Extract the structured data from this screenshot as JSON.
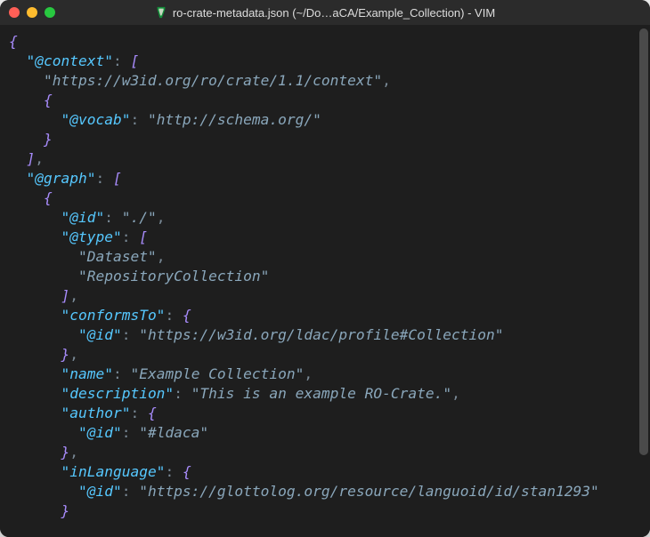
{
  "window": {
    "title": "ro-crate-metadata.json (~/Do…aCA/Example_Collection) - VIM",
    "icon_name": "vim-icon"
  },
  "code": {
    "lines": [
      {
        "indent": 0,
        "tokens": [
          {
            "t": "brace",
            "v": "{"
          }
        ]
      },
      {
        "indent": 1,
        "tokens": [
          {
            "t": "key",
            "v": "\"@context\""
          },
          {
            "t": "punct",
            "v": ":"
          },
          {
            "t": "sp",
            "v": " "
          },
          {
            "t": "brace",
            "v": "["
          }
        ]
      },
      {
        "indent": 2,
        "tokens": [
          {
            "t": "str",
            "v": "\"https://w3id.org/ro/crate/1.1/context\""
          },
          {
            "t": "comma",
            "v": ","
          }
        ]
      },
      {
        "indent": 2,
        "tokens": [
          {
            "t": "brace",
            "v": "{"
          }
        ]
      },
      {
        "indent": 3,
        "tokens": [
          {
            "t": "key",
            "v": "\"@vocab\""
          },
          {
            "t": "punct",
            "v": ":"
          },
          {
            "t": "sp",
            "v": " "
          },
          {
            "t": "str",
            "v": "\"http://schema.org/\""
          }
        ]
      },
      {
        "indent": 2,
        "tokens": [
          {
            "t": "brace",
            "v": "}"
          }
        ]
      },
      {
        "indent": 1,
        "tokens": [
          {
            "t": "brace",
            "v": "]"
          },
          {
            "t": "comma",
            "v": ","
          }
        ]
      },
      {
        "indent": 1,
        "tokens": [
          {
            "t": "key",
            "v": "\"@graph\""
          },
          {
            "t": "punct",
            "v": ":"
          },
          {
            "t": "sp",
            "v": " "
          },
          {
            "t": "brace",
            "v": "["
          }
        ]
      },
      {
        "indent": 2,
        "tokens": [
          {
            "t": "brace",
            "v": "{"
          }
        ]
      },
      {
        "indent": 3,
        "tokens": [
          {
            "t": "key",
            "v": "\"@id\""
          },
          {
            "t": "punct",
            "v": ":"
          },
          {
            "t": "sp",
            "v": " "
          },
          {
            "t": "str",
            "v": "\"./\""
          },
          {
            "t": "comma",
            "v": ","
          }
        ]
      },
      {
        "indent": 3,
        "tokens": [
          {
            "t": "key",
            "v": "\"@type\""
          },
          {
            "t": "punct",
            "v": ":"
          },
          {
            "t": "sp",
            "v": " "
          },
          {
            "t": "brace",
            "v": "["
          }
        ]
      },
      {
        "indent": 4,
        "tokens": [
          {
            "t": "str",
            "v": "\"Dataset\""
          },
          {
            "t": "comma",
            "v": ","
          }
        ]
      },
      {
        "indent": 4,
        "tokens": [
          {
            "t": "str",
            "v": "\"RepositoryCollection\""
          }
        ]
      },
      {
        "indent": 3,
        "tokens": [
          {
            "t": "brace",
            "v": "]"
          },
          {
            "t": "comma",
            "v": ","
          }
        ]
      },
      {
        "indent": 3,
        "tokens": [
          {
            "t": "key",
            "v": "\"conformsTo\""
          },
          {
            "t": "punct",
            "v": ":"
          },
          {
            "t": "sp",
            "v": " "
          },
          {
            "t": "brace",
            "v": "{"
          }
        ]
      },
      {
        "indent": 4,
        "tokens": [
          {
            "t": "key",
            "v": "\"@id\""
          },
          {
            "t": "punct",
            "v": ":"
          },
          {
            "t": "sp",
            "v": " "
          },
          {
            "t": "str",
            "v": "\"https://w3id.org/ldac/profile#Collection\""
          }
        ]
      },
      {
        "indent": 3,
        "tokens": [
          {
            "t": "brace",
            "v": "}"
          },
          {
            "t": "comma",
            "v": ","
          }
        ]
      },
      {
        "indent": 3,
        "tokens": [
          {
            "t": "key",
            "v": "\"name\""
          },
          {
            "t": "punct",
            "v": ":"
          },
          {
            "t": "sp",
            "v": " "
          },
          {
            "t": "str",
            "v": "\"Example Collection\""
          },
          {
            "t": "comma",
            "v": ","
          }
        ]
      },
      {
        "indent": 3,
        "tokens": [
          {
            "t": "key",
            "v": "\"description\""
          },
          {
            "t": "punct",
            "v": ":"
          },
          {
            "t": "sp",
            "v": " "
          },
          {
            "t": "str",
            "v": "\"This is an example RO-Crate.\""
          },
          {
            "t": "comma",
            "v": ","
          }
        ]
      },
      {
        "indent": 3,
        "tokens": [
          {
            "t": "key",
            "v": "\"author\""
          },
          {
            "t": "punct",
            "v": ":"
          },
          {
            "t": "sp",
            "v": " "
          },
          {
            "t": "brace",
            "v": "{"
          }
        ]
      },
      {
        "indent": 4,
        "tokens": [
          {
            "t": "key",
            "v": "\"@id\""
          },
          {
            "t": "punct",
            "v": ":"
          },
          {
            "t": "sp",
            "v": " "
          },
          {
            "t": "str",
            "v": "\"#ldaca\""
          }
        ]
      },
      {
        "indent": 3,
        "tokens": [
          {
            "t": "brace",
            "v": "}"
          },
          {
            "t": "comma",
            "v": ","
          }
        ]
      },
      {
        "indent": 3,
        "tokens": [
          {
            "t": "key",
            "v": "\"inLanguage\""
          },
          {
            "t": "punct",
            "v": ":"
          },
          {
            "t": "sp",
            "v": " "
          },
          {
            "t": "brace",
            "v": "{"
          }
        ]
      },
      {
        "indent": 4,
        "tokens": [
          {
            "t": "key",
            "v": "\"@id\""
          },
          {
            "t": "punct",
            "v": ":"
          },
          {
            "t": "sp",
            "v": " "
          },
          {
            "t": "str",
            "v": "\"https://glottolog.org/resource/languoid/id/stan1293\""
          }
        ]
      },
      {
        "indent": 3,
        "tokens": [
          {
            "t": "brace",
            "v": "}"
          }
        ]
      }
    ],
    "indent_unit": "  "
  }
}
